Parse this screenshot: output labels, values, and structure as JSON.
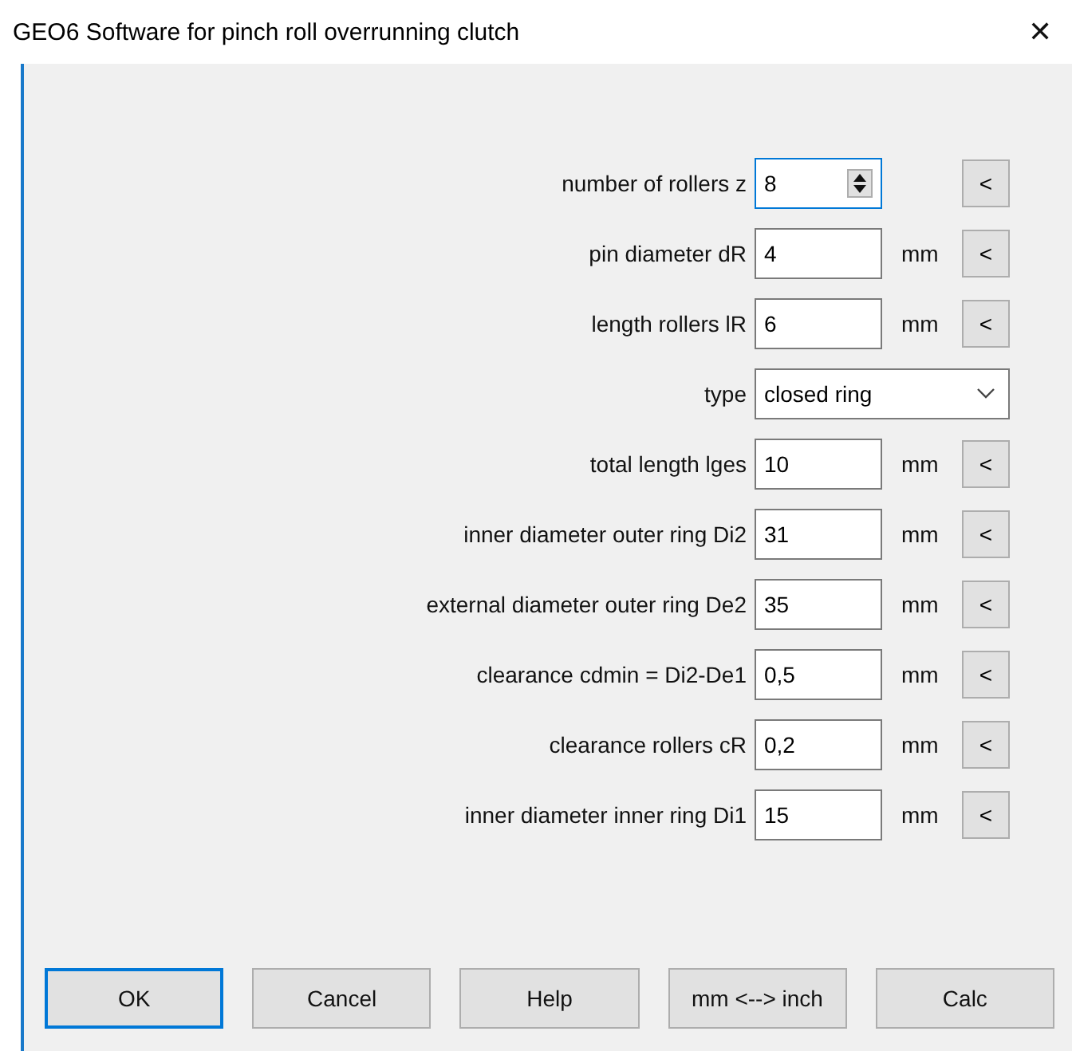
{
  "window": {
    "title": "GEO6  Software for pinch roll overrunning clutch",
    "close": "✕"
  },
  "fields": [
    {
      "kind": "spin",
      "label": "number of rollers z",
      "value": "8",
      "focused": true,
      "reset": "<"
    },
    {
      "kind": "number",
      "label": "pin diameter dR",
      "value": "4",
      "unit": "mm",
      "reset": "<"
    },
    {
      "kind": "number",
      "label": "length rollers lR",
      "value": "6",
      "unit": "mm",
      "reset": "<"
    },
    {
      "kind": "select",
      "label": "type",
      "value": "closed ring"
    },
    {
      "kind": "number",
      "label": "total length lges",
      "value": "10",
      "unit": "mm",
      "reset": "<"
    },
    {
      "kind": "number",
      "label": "inner diameter outer ring Di2",
      "value": "31",
      "unit": "mm",
      "reset": "<"
    },
    {
      "kind": "number",
      "label": "external diameter outer ring De2",
      "value": "35",
      "unit": "mm",
      "reset": "<"
    },
    {
      "kind": "number",
      "label": "clearance cdmin = Di2-De1",
      "value": "0,5",
      "unit": "mm",
      "reset": "<"
    },
    {
      "kind": "number",
      "label": "clearance rollers cR",
      "value": "0,2",
      "unit": "mm",
      "reset": "<"
    },
    {
      "kind": "number",
      "label": "inner diameter inner ring Di1",
      "value": "15",
      "unit": "mm",
      "reset": "<"
    }
  ],
  "buttons": [
    {
      "label": "OK",
      "default": true
    },
    {
      "label": "Cancel",
      "default": false
    },
    {
      "label": "Help",
      "default": false
    },
    {
      "label": "mm <--> inch",
      "default": false
    },
    {
      "label": "Calc",
      "default": false
    }
  ]
}
